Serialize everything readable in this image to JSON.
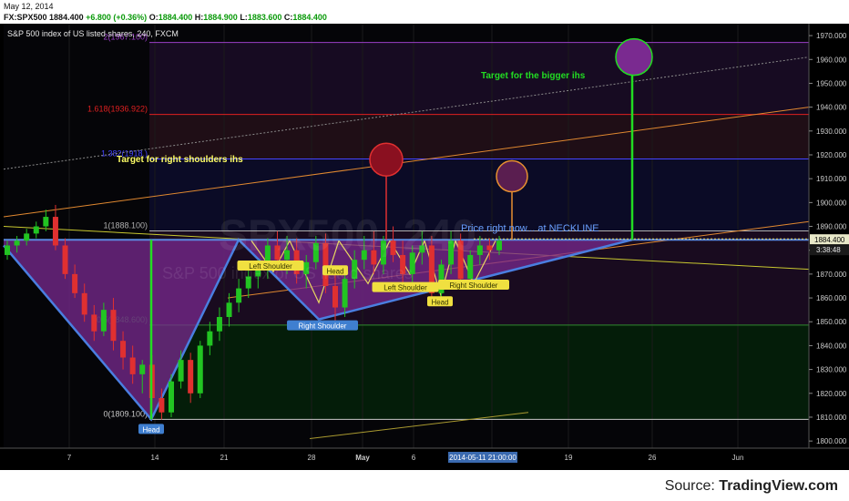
{
  "header": {
    "date": "May 12, 2014",
    "symbol": "FX:SPX500",
    "last": "1884.400",
    "change": "+6.800 (+0.36%)",
    "o_label": "O:",
    "o_value": "1884.400",
    "h_label": "H:",
    "h_value": "1884.900",
    "l_label": "L:",
    "l_value": "1883.600",
    "c_label": "C:",
    "c_value": "1884.400"
  },
  "chart_data": {
    "type": "candlestick",
    "title": "S&P 500 index of US listed shares, 240, FXCM",
    "watermark": "SPX500, 240",
    "watermark_sub": "S&P 500 index of US listed shares",
    "ylim": [
      1797,
      1975
    ],
    "y_ticks": [
      1800,
      1810,
      1820,
      1830,
      1840,
      1850,
      1860,
      1870,
      1880,
      1890,
      1900,
      1910,
      1920,
      1930,
      1940,
      1950,
      1960,
      1970
    ],
    "x_ticks": [
      "7",
      "14",
      "21",
      "28",
      "May",
      "6",
      "",
      "19",
      "26",
      "Jun"
    ],
    "x_highlight": "2014-05-11 21:00:00",
    "price_label": "1884.400",
    "countdown_label": "3:38:48",
    "fib_levels": [
      {
        "label": "0(1809.100)",
        "value": 1809.1,
        "color": "#c8c8c8"
      },
      {
        "label": "0.5(1848.600)",
        "value": 1848.6,
        "color": "#2e8b2e"
      },
      {
        "label": "1(1888.100)",
        "value": 1888.1,
        "color": "#b0b0b0"
      },
      {
        "label": "1.382(1918.)",
        "value": 1918.3,
        "color": "#4444ff"
      },
      {
        "label": "1.618(1936.922)",
        "value": 1936.922,
        "color": "#e02020"
      },
      {
        "label": "2(1967.100)",
        "value": 1967.1,
        "color": "#9b40c8"
      }
    ],
    "neckline": 1884.4,
    "annotations": [
      {
        "text": "Target  for the bigger ihs",
        "color": "#22dd22"
      },
      {
        "text": "Target  for right shoulders ihs",
        "color": "#ffff66"
      },
      {
        "text": "Price right now... at NECKLINE",
        "color": "#6aa0ff"
      }
    ],
    "pattern_labels": [
      {
        "text": "Head",
        "color": "#3f7fd0"
      },
      {
        "text": "Right Shoulder",
        "color": "#3f7fd0"
      },
      {
        "text": "Left Shoulder",
        "color": "#f0e040"
      },
      {
        "text": "Head",
        "color": "#f0e040"
      },
      {
        "text": "Left Shoulder",
        "color": "#f0e040"
      },
      {
        "text": "Head",
        "color": "#f0e040"
      },
      {
        "text": "Right Shoulder",
        "color": "#f0e040"
      }
    ],
    "candles": [
      [
        1878,
        1884,
        1876,
        1882
      ],
      [
        1882,
        1886,
        1879,
        1884
      ],
      [
        1884,
        1889,
        1882,
        1887
      ],
      [
        1887,
        1892,
        1885,
        1890
      ],
      [
        1890,
        1897,
        1888,
        1894
      ],
      [
        1894,
        1899,
        1880,
        1882
      ],
      [
        1882,
        1885,
        1868,
        1870
      ],
      [
        1870,
        1874,
        1860,
        1862
      ],
      [
        1862,
        1866,
        1850,
        1853
      ],
      [
        1853,
        1857,
        1842,
        1846
      ],
      [
        1846,
        1858,
        1844,
        1855
      ],
      [
        1855,
        1860,
        1838,
        1842
      ],
      [
        1842,
        1846,
        1830,
        1835
      ],
      [
        1835,
        1840,
        1824,
        1828
      ],
      [
        1828,
        1834,
        1820,
        1832
      ],
      [
        1832,
        1836,
        1814,
        1818
      ],
      [
        1818,
        1822,
        1809,
        1812
      ],
      [
        1812,
        1828,
        1810,
        1825
      ],
      [
        1825,
        1838,
        1822,
        1834
      ],
      [
        1834,
        1837,
        1816,
        1820
      ],
      [
        1820,
        1842,
        1818,
        1840
      ],
      [
        1840,
        1850,
        1836,
        1846
      ],
      [
        1846,
        1856,
        1842,
        1852
      ],
      [
        1852,
        1862,
        1848,
        1858
      ],
      [
        1858,
        1868,
        1854,
        1864
      ],
      [
        1864,
        1872,
        1860,
        1869
      ],
      [
        1869,
        1876,
        1864,
        1872
      ],
      [
        1872,
        1885,
        1868,
        1882
      ],
      [
        1882,
        1888,
        1872,
        1876
      ],
      [
        1876,
        1886,
        1870,
        1880
      ],
      [
        1880,
        1885,
        1866,
        1870
      ],
      [
        1870,
        1878,
        1864,
        1875
      ],
      [
        1875,
        1886,
        1872,
        1883
      ],
      [
        1883,
        1887,
        1862,
        1865
      ],
      [
        1865,
        1870,
        1850,
        1856
      ],
      [
        1856,
        1872,
        1852,
        1868
      ],
      [
        1868,
        1880,
        1864,
        1876
      ],
      [
        1876,
        1886,
        1872,
        1880
      ],
      [
        1880,
        1888,
        1870,
        1874
      ],
      [
        1874,
        1886,
        1870,
        1884
      ],
      [
        1884,
        1890,
        1875,
        1878
      ],
      [
        1878,
        1884,
        1866,
        1870
      ],
      [
        1870,
        1882,
        1866,
        1879
      ],
      [
        1879,
        1888,
        1874,
        1882
      ],
      [
        1882,
        1886,
        1858,
        1862
      ],
      [
        1862,
        1876,
        1858,
        1874
      ],
      [
        1874,
        1888,
        1870,
        1884
      ],
      [
        1884,
        1887,
        1864,
        1868
      ],
      [
        1868,
        1880,
        1864,
        1878
      ],
      [
        1878,
        1886,
        1874,
        1882
      ],
      [
        1882,
        1885,
        1876,
        1880
      ],
      [
        1880,
        1886,
        1878,
        1884
      ]
    ]
  },
  "footer": {
    "source_label": "Source:",
    "source_brand": "TradingView.com"
  }
}
